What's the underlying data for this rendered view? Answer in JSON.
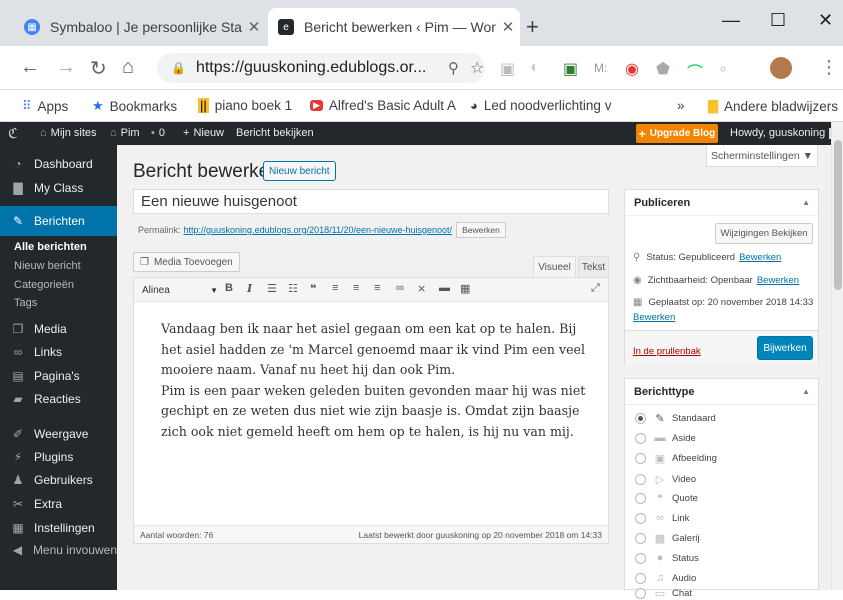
{
  "browser": {
    "tabs": [
      {
        "title": "Symbaloo | Je persoonlijke Startp",
        "active": false,
        "close": "✕"
      },
      {
        "title": "Bericht bewerken ‹ Pim — WordF",
        "active": true,
        "close": "✕"
      }
    ],
    "new_tab": "+",
    "window": {
      "minimize": "—",
      "maximize": "☐",
      "close": "✕"
    },
    "url": "https://guuskoning.edublogs.or...",
    "bookmarks": [
      {
        "icon": "apps-icon",
        "label": "Apps"
      },
      {
        "icon": "star-icon",
        "label": "Bookmarks"
      },
      {
        "icon": "piano-icon",
        "label": "piano boek 1"
      },
      {
        "icon": "youtube-icon",
        "label": "Alfred's Basic Adult A"
      },
      {
        "icon": "bulb-icon",
        "label": "Led noodverlichting v"
      }
    ],
    "more": "»",
    "other_bookmarks": "Andere bladwijzers"
  },
  "adminbar": {
    "my_sites": "Mijn sites",
    "site": "Pim",
    "comments": "0",
    "new": "Nieuw",
    "view": "Bericht bekijken",
    "upgrade": "Upgrade Blog",
    "howdy": "Howdy, guuskoning"
  },
  "sidebar": {
    "items": [
      {
        "label": "Dashboard",
        "icon": "dashboard-icon"
      },
      {
        "label": "My Class",
        "icon": "class-icon"
      },
      {
        "label": "Berichten",
        "icon": "pin-icon",
        "current": true
      },
      {
        "label": "Media",
        "icon": "media-icon"
      },
      {
        "label": "Links",
        "icon": "link-icon"
      },
      {
        "label": "Pagina's",
        "icon": "pages-icon"
      },
      {
        "label": "Reacties",
        "icon": "comments-icon"
      },
      {
        "label": "Weergave",
        "icon": "brush-icon"
      },
      {
        "label": "Plugins",
        "icon": "plugin-icon"
      },
      {
        "label": "Gebruikers",
        "icon": "users-icon"
      },
      {
        "label": "Extra",
        "icon": "tools-icon"
      },
      {
        "label": "Instellingen",
        "icon": "settings-icon"
      },
      {
        "label": "Menu invouwen",
        "icon": "collapse-icon"
      }
    ],
    "submenu": [
      "Alle berichten",
      "Nieuw bericht",
      "Categorieën",
      "Tags"
    ]
  },
  "page": {
    "screen_options": "Scherminstellingen ▼",
    "heading": "Bericht bewerken",
    "new_post": "Nieuw bericht",
    "title_value": "Een nieuwe huisgenoot",
    "permalink_label": "Permalink:",
    "permalink_url": "http://guuskoning.edublogs.org/2018/11/20/een-nieuwe-huisgenoot/",
    "permalink_edit": "Bewerken",
    "add_media": "Media Toevoegen",
    "tab_visual": "Visueel",
    "tab_text": "Tekst",
    "format_select": "Alinea",
    "content": [
      "Vandaag ben ik naar het asiel gegaan om een kat op te halen. Bij het asiel hadden ze 'm Marcel genoemd maar ik vind Pim een veel mooiere naam. Vanaf nu heet hij dan ook Pim.",
      "Pim is een paar weken geleden buiten gevonden maar hij was niet gechipt en ze weten dus niet wie zijn baasje is. Omdat zijn baasje zich ook niet gemeld heeft om hem op te halen, is hij nu van mij."
    ],
    "word_count": "Aantal woorden: 76",
    "last_edited": "Laatst bewerkt door guuskoning op 20 november 2018 om 14:33"
  },
  "publish": {
    "title": "Publiceren",
    "preview": "Wijzigingen Bekijken",
    "status_label": "Status: Gepubliceerd",
    "visibility_label": "Zichtbaarheid: Openbaar",
    "published_label": "Geplaatst op: 20 november 2018 14:33",
    "edit": "Bewerken",
    "trash": "In de prullenbak",
    "update": "Bijwerken"
  },
  "format": {
    "title": "Berichttype",
    "options": [
      {
        "label": "Standaard",
        "icon": "pin-icon",
        "checked": true
      },
      {
        "label": "Aside",
        "icon": "aside-icon"
      },
      {
        "label": "Afbeelding",
        "icon": "image-icon"
      },
      {
        "label": "Video",
        "icon": "video-icon"
      },
      {
        "label": "Quote",
        "icon": "quote-icon"
      },
      {
        "label": "Link",
        "icon": "link-icon"
      },
      {
        "label": "Galerij",
        "icon": "gallery-icon"
      },
      {
        "label": "Status",
        "icon": "status-icon"
      },
      {
        "label": "Audio",
        "icon": "audio-icon"
      },
      {
        "label": "Chat",
        "icon": "chat-icon"
      }
    ]
  },
  "colors": {
    "adminbar": "#23282d",
    "accent": "#0073aa",
    "upgrade": "#f18500"
  }
}
